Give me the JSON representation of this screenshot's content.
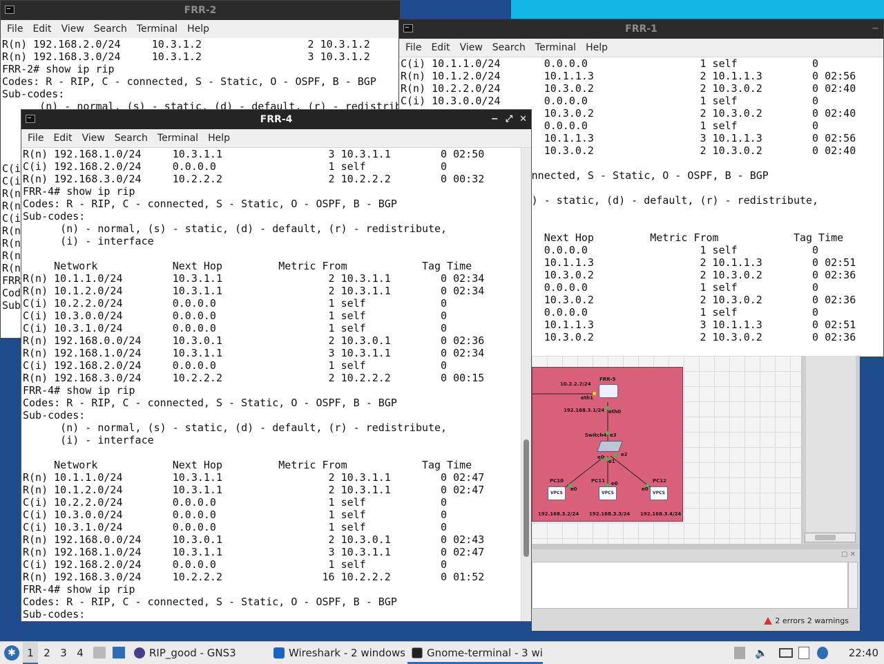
{
  "windows": {
    "frr2": {
      "title": "FRR-2",
      "controls": [
        "−",
        "⤢",
        "✕"
      ],
      "menu": [
        "File",
        "Edit",
        "View",
        "Search",
        "Terminal",
        "Help"
      ],
      "text": "R(n) 192.168.2.0/24     10.3.1.2                 2 10.3.1.2\nR(n) 192.168.3.0/24     10.3.1.2                 3 10.3.1.2\nFRR-2# show ip rip\nCodes: R - RIP, C - connected, S - Static, O - OSPF, B - BGP\nSub-codes:\n      (n) - normal, (s) - static, (d) - default, (r) - redistribute,\n\n\n\n\nC(i\nC(i\nR(n\nR(n\nC(i\nR(n\nR(n\nR(n\nR(n\nFRR\nCod\nSub"
    },
    "frr1": {
      "title": "FRR-1",
      "controls": [
        "−"
      ],
      "menu": [
        "File",
        "Edit",
        "View",
        "Search",
        "Terminal",
        "Help"
      ],
      "text": "C(i) 10.1.1.0/24       0.0.0.0                  1 self            0\nR(n) 10.1.2.0/24       10.1.1.3                 2 10.1.1.3        0 02:56\nR(n) 10.2.2.0/24       10.3.0.2                 2 10.3.0.2        0 02:40\nC(i) 10.3.0.0/24       0.0.0.0                  1 self            0\n                       10.3.0.2                 2 10.3.0.2        0 02:40\n                       0.0.0.0                  1 self            0\n                       10.1.1.3                 3 10.1.1.3        0 02:56\n                       10.3.0.2                 2 10.3.0.2        0 02:40\n\n                    onnected, S - Static, O - OSPF, B - BGP\n\n                    s) - static, (d) - default, (r) - redistribute,\n\n\n                       Next Hop         Metric From            Tag Time\n                       0.0.0.0                  1 self            0\n                       10.1.1.3                 2 10.1.1.3        0 02:51\n                       10.3.0.2                 2 10.3.0.2        0 02:36\n                       0.0.0.0                  1 self            0\n                       10.3.0.2                 2 10.3.0.2        0 02:36\n                       0.0.0.0                  1 self            0\n                       10.1.1.3                 3 10.1.1.3        0 02:51\n                       10.3.0.2                 2 10.3.0.2        0 02:36"
    },
    "frr4": {
      "title": "FRR-4",
      "controls": [
        "−",
        "⤢",
        "✕"
      ],
      "menu": [
        "File",
        "Edit",
        "View",
        "Search",
        "Terminal",
        "Help"
      ],
      "text": "R(n) 192.168.1.0/24     10.3.1.1                 3 10.3.1.1        0 02:50\nC(i) 192.168.2.0/24     0.0.0.0                  1 self            0\nR(n) 192.168.3.0/24     10.2.2.2                 2 10.2.2.2        0 00:32\nFRR-4# show ip rip\nCodes: R - RIP, C - connected, S - Static, O - OSPF, B - BGP\nSub-codes:\n      (n) - normal, (s) - static, (d) - default, (r) - redistribute,\n      (i) - interface\n\n     Network            Next Hop         Metric From            Tag Time\nR(n) 10.1.1.0/24        10.3.1.1                 2 10.3.1.1        0 02:34\nR(n) 10.1.2.0/24        10.3.1.1                 2 10.3.1.1        0 02:34\nC(i) 10.2.2.0/24        0.0.0.0                  1 self            0\nC(i) 10.3.0.0/24        0.0.0.0                  1 self            0\nC(i) 10.3.1.0/24        0.0.0.0                  1 self            0\nR(n) 192.168.0.0/24     10.3.0.1                 2 10.3.0.1        0 02:36\nR(n) 192.168.1.0/24     10.3.1.1                 3 10.3.1.1        0 02:34\nC(i) 192.168.2.0/24     0.0.0.0                  1 self            0\nR(n) 192.168.3.0/24     10.2.2.2                 2 10.2.2.2        0 00:15\nFRR-4# show ip rip\nCodes: R - RIP, C - connected, S - Static, O - OSPF, B - BGP\nSub-codes:\n      (n) - normal, (s) - static, (d) - default, (r) - redistribute,\n      (i) - interface\n\n     Network            Next Hop         Metric From            Tag Time\nR(n) 10.1.1.0/24        10.3.1.1                 2 10.3.1.1        0 02:47\nR(n) 10.1.2.0/24        10.3.1.1                 2 10.3.1.1        0 02:47\nC(i) 10.2.2.0/24        0.0.0.0                  1 self            0\nC(i) 10.3.0.0/24        0.0.0.0                  1 self            0\nC(i) 10.3.1.0/24        0.0.0.0                  1 self            0\nR(n) 192.168.0.0/24     10.3.0.1                 2 10.3.0.1        0 02:43\nR(n) 192.168.1.0/24     10.3.1.1                 3 10.3.1.1        0 02:47\nC(i) 192.168.2.0/24     0.0.0.0                  1 self            0\nR(n) 192.168.3.0/24     10.2.2.2                16 10.2.2.2        0 01:52\nFRR-4# show ip rip\nCodes: R - RIP, C - connected, S - Static, O - OSPF, B - BGP\nSub-codes:"
    }
  },
  "gns3": {
    "status": "2 errors 2 warnings",
    "topology": {
      "router": "FRR-5",
      "switch": "Switch4",
      "pcs": [
        {
          "name": "PC10",
          "ip": "192.168.3.2/24",
          "iface": "e0"
        },
        {
          "name": "PC11",
          "ip": "192.168.3.3/24",
          "iface": "e0"
        },
        {
          "name": "PC12",
          "ip": "192.168.3.4/24",
          "iface": "e0"
        }
      ],
      "labels": {
        "link_ip": "10.2.2.2/24",
        "eth1": "eth1",
        "eth0": "eth0",
        "lan_ip": "192.168.3.1/24",
        "e3": "e3",
        "e0": "e0",
        "e1": "e1",
        "e2": "e2",
        "vpcs": "VPCS"
      }
    }
  },
  "taskbar": {
    "workspaces": [
      "1",
      "2",
      "3",
      "4"
    ],
    "active_workspace": "1",
    "tasks": [
      {
        "label": "RIP_good - GNS3",
        "icon": "gns3-icon"
      },
      {
        "label": "Wireshark - 2 windows",
        "icon": "wireshark-icon"
      },
      {
        "label": "Gnome-terminal - 3 wi...",
        "icon": "terminal-icon"
      }
    ],
    "clock": "22:40"
  }
}
